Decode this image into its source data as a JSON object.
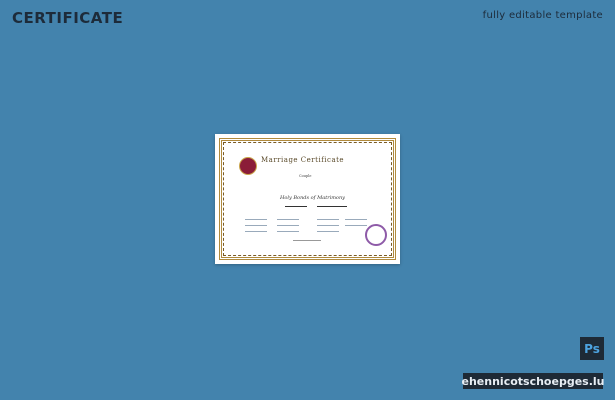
{
  "header": {
    "title": "CERTIFICATE",
    "subtitle": "fully editable template"
  },
  "certificate": {
    "heading": "Marriage Certificate",
    "intro": "Couple",
    "bond_text": "Holy Bonds of Matrimony"
  },
  "badges": {
    "app_badge": "Ps",
    "watermark": "ehennicotschoepges.lu"
  },
  "colors": {
    "background": "#4383ad",
    "badge_bg": "#1e2a36",
    "ps_blue": "#4da3e0"
  }
}
